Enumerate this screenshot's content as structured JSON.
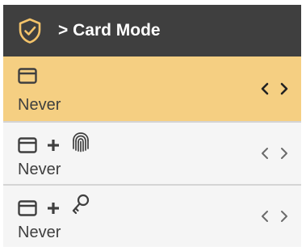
{
  "header": {
    "title": "> Card Mode",
    "icon": "shield-check-icon"
  },
  "modes": [
    {
      "icons": [
        "card-icon"
      ],
      "value": "Never",
      "selected": true
    },
    {
      "icons": [
        "card-icon",
        "plus-icon",
        "fingerprint-icon"
      ],
      "value": "Never",
      "selected": false
    },
    {
      "icons": [
        "card-icon",
        "plus-icon",
        "key-icon"
      ],
      "value": "Never",
      "selected": false
    }
  ],
  "colors": {
    "header_bg": "#3f3f3f",
    "selected_bg": "#f5cf82",
    "accent": "#f3c36a",
    "text": "#3f3f3f"
  }
}
